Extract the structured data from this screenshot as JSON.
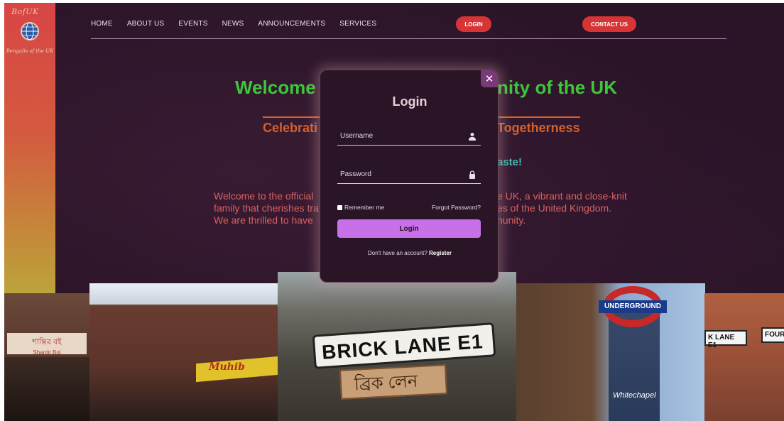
{
  "brand": {
    "logo_text": "BofUK",
    "tagline": "Bengalis of the UK"
  },
  "nav": {
    "items": [
      "HOME",
      "ABOUT US",
      "EVENTS",
      "NEWS",
      "ANNOUNCEMENTS",
      "SERVICES"
    ],
    "login_label": "LOGIN",
    "contact_label": "CONTACT US"
  },
  "hero": {
    "welcome_left": "Welcome t",
    "welcome_right": "nity of the UK",
    "celebrate_left": "Celebrati",
    "celebrate_right": "Togetherness",
    "taste_right": "aste!",
    "para_line1_left": "Welcome to the official",
    "para_line1_right": "e UK, a vibrant and close-knit",
    "para_line2_left": "family that cherishes tra",
    "para_line2_right": "es of the United Kingdom.",
    "para_line3_left": "We are thrilled to have",
    "para_line3_right": "nunity."
  },
  "photos": {
    "p1_sign": "শান্তির বই",
    "p1_sub": "Shantir Boi",
    "p2_sign": "Muhib",
    "p3_sign": "BRICK LANE E1",
    "p3_bengali": "ব্রিক লেন",
    "p4_sign": "UNDERGROUND",
    "p4_station": "Whitechapel",
    "p5_sign1": "K LANE E1",
    "p5_sign2": "FOUR"
  },
  "modal": {
    "close_glyph": "✕",
    "title": "Login",
    "username_placeholder": "Username",
    "password_placeholder": "Password",
    "remember_label": "Remember me",
    "forgot_label": "Forgot Password?",
    "submit_label": "Login",
    "register_prompt": "Don't have an account?",
    "register_link": "Register"
  },
  "colors": {
    "accent_red": "#d73535",
    "welcome_green": "#3cc63a",
    "celebrate_orange": "#d4602c",
    "taste_teal": "#43b7b0",
    "login_purple": "#c770e8"
  }
}
